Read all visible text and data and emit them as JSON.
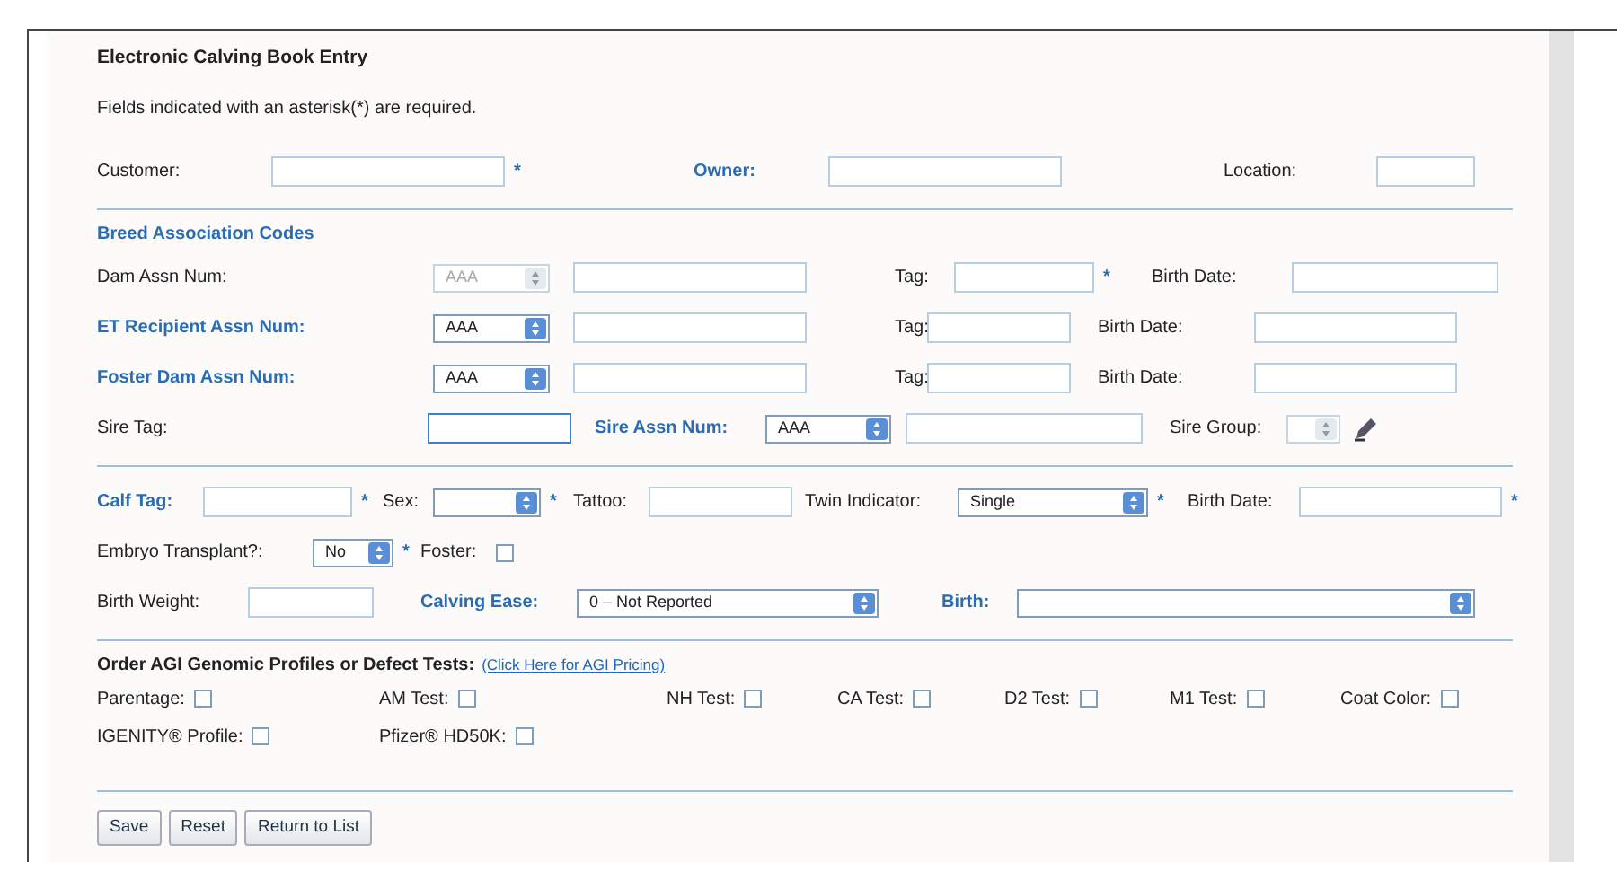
{
  "form": {
    "title": "Electronic Calving Book Entry",
    "note": "Fields indicated with an asterisk(*) are required.",
    "sections": [
      {
        "rows": [
          {
            "items": [
              {
                "kind": "label",
                "text": "Customer:",
                "emphasized": false
              },
              {
                "kind": "field",
                "asterisk": "*",
                "focused": false
              },
              {
                "kind": "label",
                "text": "Owner:",
                "emphasized": true
              },
              {
                "kind": "field",
                "focused": false
              },
              {
                "kind": "label",
                "text": "Location:",
                "emphasized": false
              },
              {
                "kind": "field",
                "focused": false
              }
            ]
          }
        ]
      },
      {
        "heading": "Breed Association Codes",
        "rows": [
          {
            "items": [
              {
                "kind": "label",
                "text": "Dam Assn Num:",
                "emphasized": false
              },
              {
                "kind": "select",
                "value": "AAA",
                "disabled": true
              },
              {
                "kind": "field",
                "focused": false
              },
              {
                "kind": "label",
                "text": "Tag:",
                "emphasized": false
              },
              {
                "kind": "field",
                "asterisk": "*",
                "focused": false
              },
              {
                "kind": "label",
                "text": "Birth Date:",
                "emphasized": false
              },
              {
                "kind": "field",
                "focused": false
              }
            ]
          },
          {
            "items": [
              {
                "kind": "label",
                "text": "ET Recipient Assn Num:",
                "emphasized": true
              },
              {
                "kind": "select",
                "value": "AAA",
                "disabled": false
              },
              {
                "kind": "field",
                "focused": false
              },
              {
                "kind": "label",
                "text": "Tag:",
                "emphasized": false
              },
              {
                "kind": "field",
                "focused": false
              },
              {
                "kind": "label",
                "text": "Birth Date:",
                "emphasized": false
              },
              {
                "kind": "field",
                "focused": false
              }
            ]
          },
          {
            "items": [
              {
                "kind": "label",
                "text": "Foster Dam Assn Num:",
                "emphasized": true
              },
              {
                "kind": "select",
                "value": "AAA",
                "disabled": false
              },
              {
                "kind": "field",
                "focused": false
              },
              {
                "kind": "label",
                "text": "Tag:",
                "emphasized": false
              },
              {
                "kind": "field",
                "focused": false
              },
              {
                "kind": "label",
                "text": "Birth Date:",
                "emphasized": false
              },
              {
                "kind": "field",
                "focused": false
              }
            ]
          },
          {
            "items": [
              {
                "kind": "label",
                "text": "Sire Tag:",
                "emphasized": false
              },
              {
                "kind": "field",
                "focused": true
              },
              {
                "kind": "label",
                "text": "Sire Assn Num:",
                "emphasized": true
              },
              {
                "kind": "select",
                "value": "AAA",
                "disabled": false
              },
              {
                "kind": "field",
                "focused": false
              },
              {
                "kind": "label",
                "text": "Sire Group:",
                "emphasized": false
              },
              {
                "kind": "select",
                "disabled": true
              },
              {
                "kind": "icon"
              }
            ]
          }
        ]
      },
      {
        "rows": [
          {
            "items": [
              {
                "kind": "label",
                "text": "Calf Tag:",
                "emphasized": true
              },
              {
                "kind": "field",
                "asterisk": "*",
                "focused": false
              },
              {
                "kind": "label",
                "text": "Sex:",
                "emphasized": false
              },
              {
                "kind": "select",
                "disabled": false,
                "asterisk": "*"
              },
              {
                "kind": "label",
                "text": "Tattoo:",
                "emphasized": false
              },
              {
                "kind": "field",
                "focused": false
              },
              {
                "kind": "label",
                "text": "Twin Indicator:",
                "emphasized": false
              },
              {
                "kind": "select",
                "value": "Single",
                "disabled": false,
                "asterisk": "*"
              },
              {
                "kind": "label",
                "text": "Birth Date:",
                "emphasized": false
              },
              {
                "kind": "field",
                "asterisk": "*",
                "focused": false
              }
            ]
          },
          {
            "items": [
              {
                "kind": "label",
                "text": "Embryo Transplant?:",
                "emphasized": false
              },
              {
                "kind": "select",
                "value": "No",
                "disabled": false,
                "asterisk": "*"
              },
              {
                "kind": "label",
                "text": "Foster:",
                "emphasized": false
              },
              {
                "kind": "checkbox",
                "checked": false
              }
            ]
          },
          {
            "items": [
              {
                "kind": "label",
                "text": "Birth Weight:",
                "emphasized": false
              },
              {
                "kind": "field",
                "focused": false
              },
              {
                "kind": "label",
                "text": "Calving Ease:",
                "emphasized": true
              },
              {
                "kind": "select",
                "value": "0 – Not Reported",
                "disabled": false
              },
              {
                "kind": "label",
                "text": "Birth:",
                "emphasized": true
              },
              {
                "kind": "select",
                "disabled": false
              }
            ]
          }
        ]
      }
    ],
    "tests": {
      "heading": "Order AGI Genomic Profiles or Defect Tests:",
      "link": "(Click Here for AGI Pricing)",
      "items": [
        {
          "label": "Parentage:",
          "checked": false
        },
        {
          "label": "AM Test:",
          "checked": false
        },
        {
          "label": "NH Test:",
          "checked": false
        },
        {
          "label": "CA Test:",
          "checked": false
        },
        {
          "label": "D2 Test:",
          "checked": false
        },
        {
          "label": "M1 Test:",
          "checked": false
        },
        {
          "label": "Coat Color:",
          "checked": false
        },
        {
          "label": "IGENITY® Profile:",
          "checked": false
        },
        {
          "label": "Pfizer® HD50K:",
          "checked": false
        }
      ]
    },
    "buttons": [
      "Save",
      "Reset",
      "Return to List"
    ]
  }
}
